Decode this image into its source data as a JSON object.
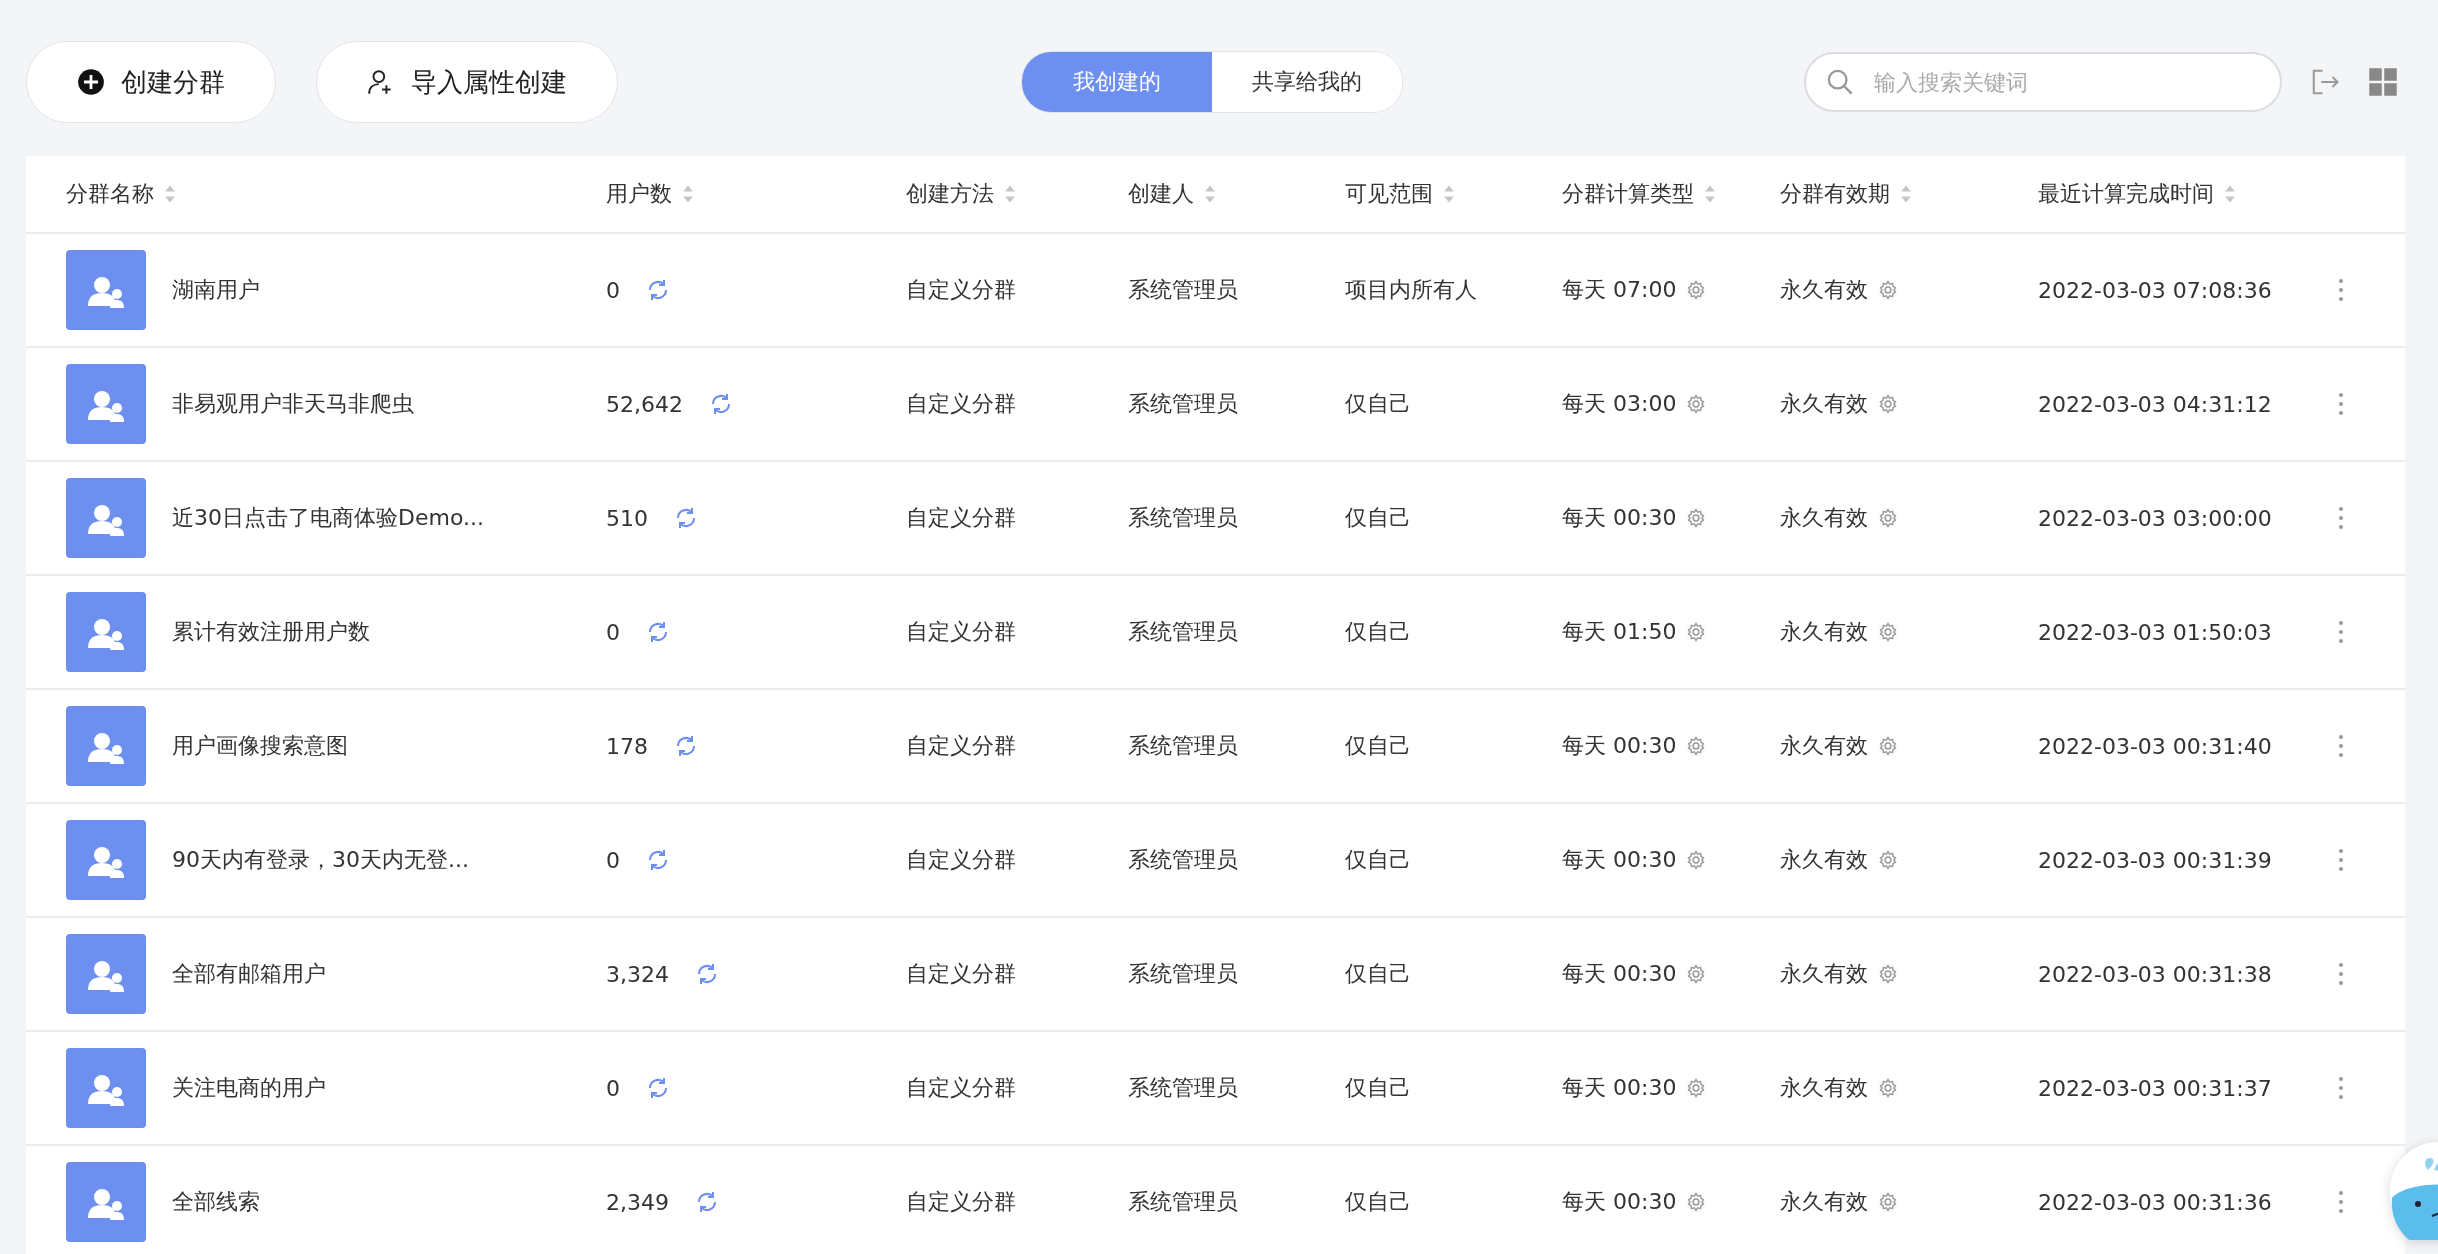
{
  "actions": [
    {
      "kind": "create",
      "label": "创建分群"
    },
    {
      "kind": "import",
      "label": "导入属性创建"
    }
  ],
  "tabs": [
    {
      "label": "我创建的",
      "selected": true
    },
    {
      "label": "共享给我的",
      "selected": false
    }
  ],
  "search": {
    "placeholder": "输入搜索关键词"
  },
  "table": {
    "columns": [
      "分群名称",
      "用户数",
      "创建方法",
      "创建人",
      "可见范围",
      "分群计算类型",
      "分群有效期",
      "最近计算完成时间"
    ],
    "rows": [
      {
        "name": "湖南用户",
        "users": "0",
        "method": "自定义分群",
        "creator": "系统管理员",
        "scope": "项目内所有人",
        "calc": "每天 07:00",
        "validity": "永久有效",
        "time": "2022-03-03 07:08:36"
      },
      {
        "name": "非易观用户非天马非爬虫",
        "users": "52,642",
        "method": "自定义分群",
        "creator": "系统管理员",
        "scope": "仅自己",
        "calc": "每天 03:00",
        "validity": "永久有效",
        "time": "2022-03-03 04:31:12"
      },
      {
        "name": "近30日点击了电商体验Demo...",
        "users": "510",
        "method": "自定义分群",
        "creator": "系统管理员",
        "scope": "仅自己",
        "calc": "每天 00:30",
        "validity": "永久有效",
        "time": "2022-03-03 03:00:00"
      },
      {
        "name": "累计有效注册用户数",
        "users": "0",
        "method": "自定义分群",
        "creator": "系统管理员",
        "scope": "仅自己",
        "calc": "每天 01:50",
        "validity": "永久有效",
        "time": "2022-03-03 01:50:03"
      },
      {
        "name": "用户画像搜索意图",
        "users": "178",
        "method": "自定义分群",
        "creator": "系统管理员",
        "scope": "仅自己",
        "calc": "每天 00:30",
        "validity": "永久有效",
        "time": "2022-03-03 00:31:40"
      },
      {
        "name": "90天内有登录，30天内无登...",
        "users": "0",
        "method": "自定义分群",
        "creator": "系统管理员",
        "scope": "仅自己",
        "calc": "每天 00:30",
        "validity": "永久有效",
        "time": "2022-03-03 00:31:39"
      },
      {
        "name": "全部有邮箱用户",
        "users": "3,324",
        "method": "自定义分群",
        "creator": "系统管理员",
        "scope": "仅自己",
        "calc": "每天 00:30",
        "validity": "永久有效",
        "time": "2022-03-03 00:31:38"
      },
      {
        "name": "关注电商的用户",
        "users": "0",
        "method": "自定义分群",
        "creator": "系统管理员",
        "scope": "仅自己",
        "calc": "每天 00:30",
        "validity": "永久有效",
        "time": "2022-03-03 00:31:37"
      },
      {
        "name": "全部线索",
        "users": "2,349",
        "method": "自定义分群",
        "creator": "系统管理员",
        "scope": "仅自己",
        "calc": "每天 00:30",
        "validity": "永久有效",
        "time": "2022-03-03 00:31:36"
      }
    ]
  }
}
